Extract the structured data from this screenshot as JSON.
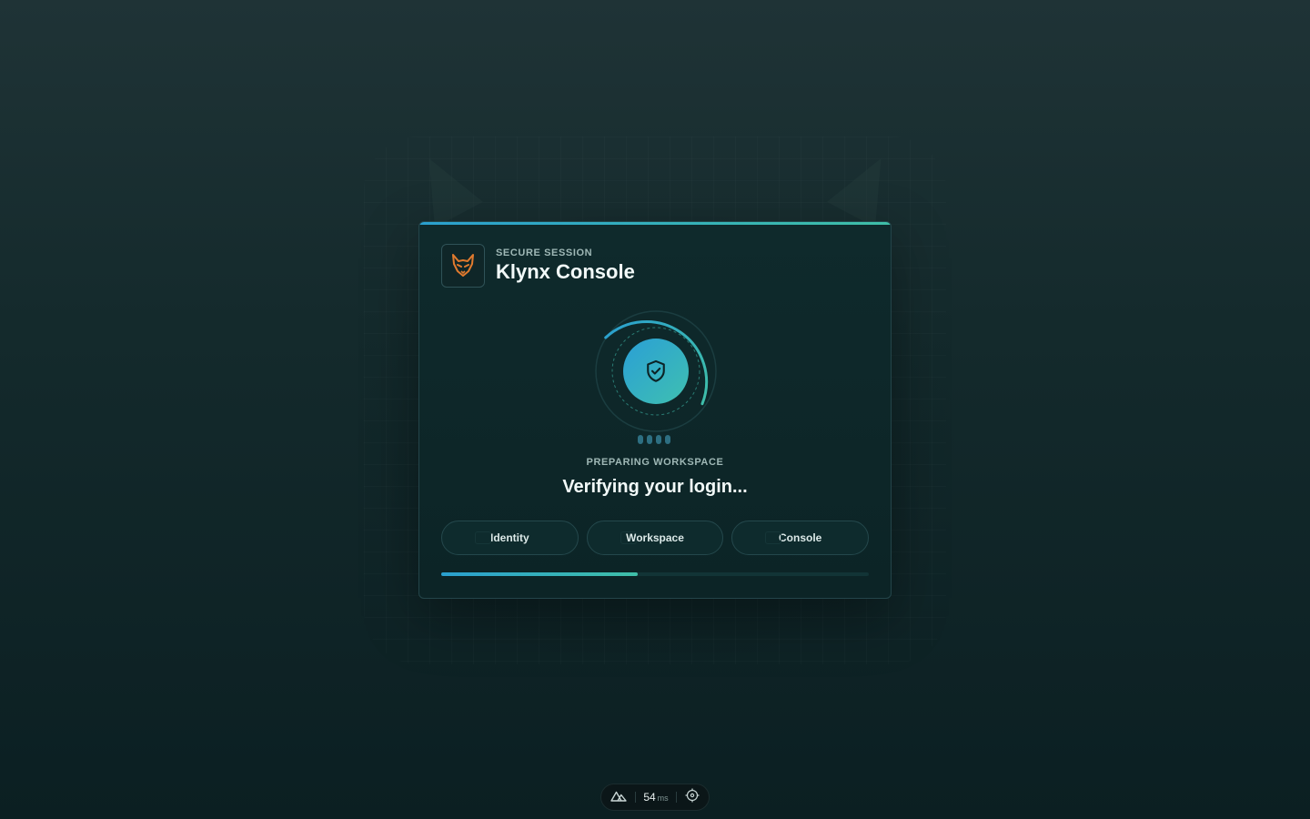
{
  "app": {
    "eyebrow": "SECURE SESSION",
    "title": "Klynx Console",
    "logo_icon": "lynx-logo-icon"
  },
  "loader": {
    "icon": "shield-check-icon",
    "status_label": "PREPARING WORKSPACE",
    "status_title": "Verifying your login...",
    "progress": 0.46
  },
  "steps": [
    {
      "label": "Identity"
    },
    {
      "label": "Workspace"
    },
    {
      "label": "Console"
    }
  ],
  "devbar": {
    "value": "54",
    "unit": "ms",
    "icons": [
      "nuxt-logo-icon",
      "crosshair-icon"
    ]
  },
  "colors": {
    "accent_blue": "#2aa0cf",
    "accent_teal": "#3fbfa8",
    "logo_orange": "#e07a2e"
  }
}
